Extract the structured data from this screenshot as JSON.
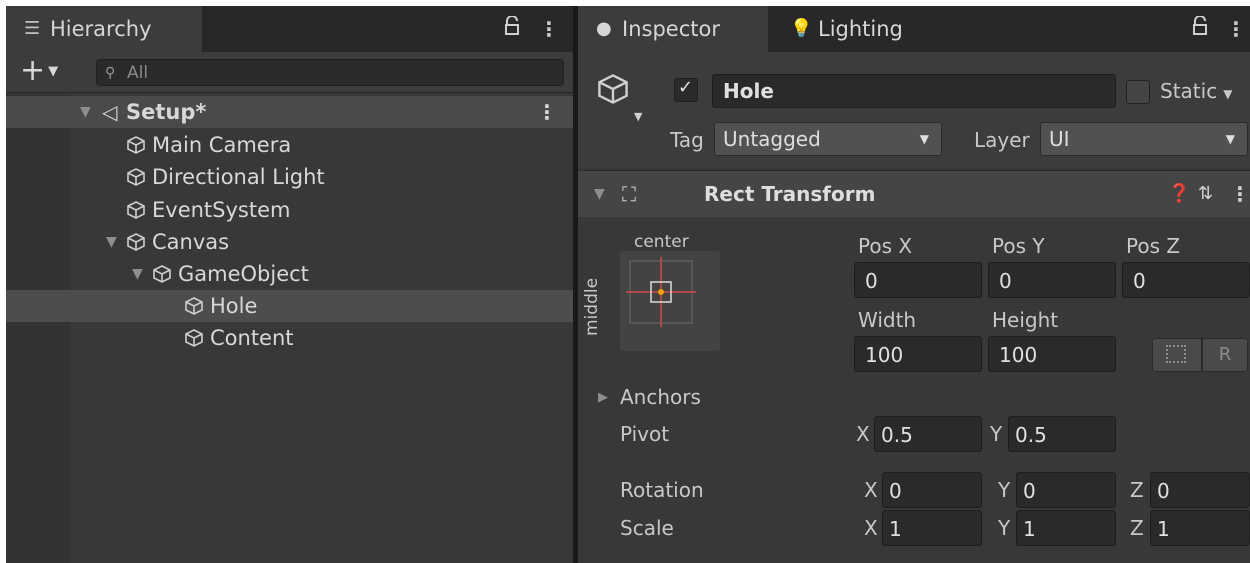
{
  "hierarchy": {
    "tab_label": "Hierarchy",
    "add_label": "+",
    "search_placeholder": "All",
    "scene": "Setup*",
    "items": [
      {
        "label": "Main Camera"
      },
      {
        "label": "Directional Light"
      },
      {
        "label": "EventSystem"
      },
      {
        "label": "Canvas"
      },
      {
        "label": "GameObject"
      },
      {
        "label": "Hole"
      },
      {
        "label": "Content"
      }
    ]
  },
  "inspector": {
    "tab_label": "Inspector",
    "lighting_tab_label": "Lighting",
    "object_name": "Hole",
    "static_label": "Static",
    "tag_label": "Tag",
    "tag_value": "Untagged",
    "layer_label": "Layer",
    "layer_value": "UI",
    "component_title": "Rect Transform",
    "anchor_h": "center",
    "anchor_v": "middle",
    "pos_x_label": "Pos X",
    "pos_y_label": "Pos Y",
    "pos_z_label": "Pos Z",
    "pos_x": "0",
    "pos_y": "0",
    "pos_z": "0",
    "width_label": "Width",
    "height_label": "Height",
    "width": "100",
    "height": "100",
    "r_button": "R",
    "anchors_label": "Anchors",
    "pivot_label": "Pivot",
    "pivot_x": "0.5",
    "pivot_y": "0.5",
    "rotation_label": "Rotation",
    "rot_x": "0",
    "rot_y": "0",
    "rot_z": "0",
    "scale_label": "Scale",
    "scale_x": "1",
    "scale_y": "1",
    "scale_z": "1",
    "axis_x": "X",
    "axis_y": "Y",
    "axis_z": "Z"
  },
  "colors": {
    "panel_bg": "#383838",
    "tab_bg": "#282828",
    "selection": "#4d4d4d",
    "field_bg": "#2a2a2a"
  }
}
